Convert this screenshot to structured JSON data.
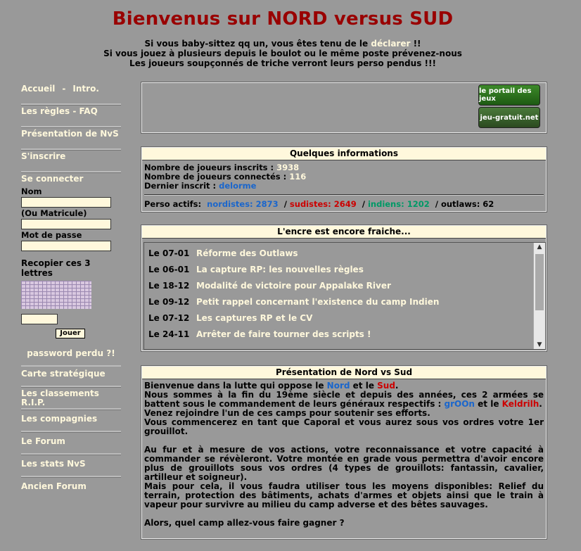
{
  "header": {
    "title": "Bienvenus sur NORD versus SUD",
    "line1_pre": "Si vous baby-sittez qq un, vous êtes tenu de le ",
    "line1_link": "déclarer",
    "line1_post": " !!",
    "line2": "Si vous jouez à plusieurs depuis le boulot ou le même poste prévenez-nous",
    "line3": "Les joueurs soupçonnés de triche verront leurs perso pendus !!!"
  },
  "sidebar": {
    "accueil": "Accueil",
    "sep": "-",
    "intro": "Intro.",
    "regles": "Les règles - FAQ",
    "presentation": "Présentation de NvS",
    "inscrire": "S'inscrire",
    "login": {
      "title": "Se connecter",
      "nom_label": "Nom",
      "matricule_label": "(Ou Matricule)",
      "pass_label": "Mot de passe",
      "captcha_label": "Recopier ces 3 lettres",
      "button": "Jouer",
      "forgot": "password perdu ?!"
    },
    "items": [
      "Carte stratégique",
      "Les classements R.I.P.",
      "Les compagnies",
      "Le Forum",
      "Les stats NvS",
      "Ancien Forum"
    ]
  },
  "banner": {
    "portal": "le portail des jeux",
    "gratuit": "jeu-gratuit.net"
  },
  "info": {
    "title": "Quelques informations",
    "inscrits_label": "Nombre de joueurs inscrits : ",
    "inscrits": "3938",
    "connectes_label": "Nombre de joueurs connectés : ",
    "connectes": "116",
    "dernier_label": "Dernier inscrit : ",
    "dernier": "delorme",
    "actifs_label": "Perso actifs:",
    "nordistes": "nordistes: 2873",
    "sudistes": "sudistes: 2649",
    "indiens": "indiens: 1202",
    "outlaws": "outlaws: 62",
    "slash": "/"
  },
  "news": {
    "title": "L'encre est encore fraiche...",
    "items": [
      {
        "date": "Le 07-01",
        "text": "Réforme des Outlaws"
      },
      {
        "date": "Le 06-01",
        "text": "La capture RP: les nouvelles règles"
      },
      {
        "date": "Le 18-12",
        "text": "Modalité de victoire pour Appalake River"
      },
      {
        "date": "Le 09-12",
        "text": "Petit rappel concernant l'existence du camp Indien"
      },
      {
        "date": "Le 07-12",
        "text": "Les captures RP et le CV"
      },
      {
        "date": "Le 24-11",
        "text": "Arrêter de faire tourner des scripts !"
      }
    ]
  },
  "presentation": {
    "title": "Présentation de Nord vs Sud",
    "p1_pre": "Bienvenue dans la lutte qui oppose le ",
    "nord": "Nord",
    "et": " et le ",
    "sud": "Sud",
    "dot": ".",
    "p2_pre": "Nous sommes à la fin du 19ème siècle et depuis des années, ces 2 armées se battent sous le commandement de leurs généraux respectifs : ",
    "gen1": "grOOn",
    "et2": " et le ",
    "gen2": "Keldrilh",
    "p3": "Venez rejoindre l'un de ces camps pour soutenir ses efforts.",
    "p4": "Vous commencerez en tant que Caporal et vous aurez sous vos ordres votre 1er grouillot.",
    "p5": "Au fur et à mesure de vos actions, votre reconnaissance et votre capacité à commander se révèleront. Votre montée en grade vous permettra d'avoir encore plus de grouillots sous vos ordres (4 types de grouillots: fantassin, cavalier, artilleur et soigneur).",
    "p6": "Mais pour cela, il vous faudra utiliser tous les moyens disponibles: Relief du terrain, protection des bâtiments, achats d'armes et objets ainsi que le train à vapeur pour survivre au milieu du camp adverse et des bêtes sauvages.",
    "p7": "Alors, quel camp allez-vous faire gagner ?"
  }
}
